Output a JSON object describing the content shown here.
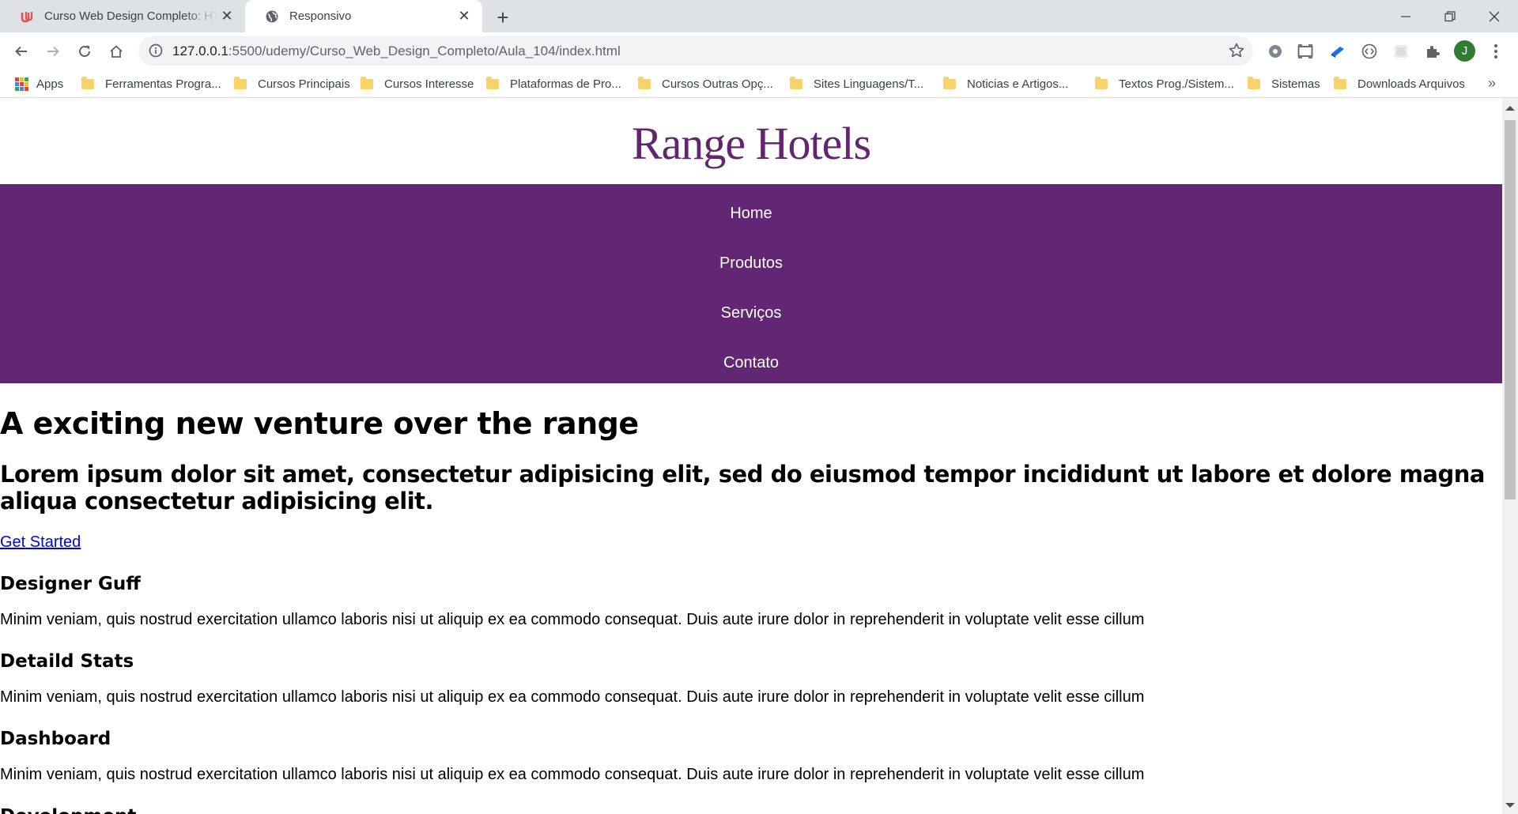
{
  "browser": {
    "tabs": [
      {
        "title": "Curso Web Design Completo: HT",
        "favicon": "udemy-icon",
        "active": false
      },
      {
        "title": "Responsivo",
        "favicon": "globe-icon",
        "active": true
      }
    ],
    "url_host": "127.0.0.1",
    "url_rest": ":5500/udemy/Curso_Web_Design_Completo/Aula_104/index.html",
    "avatar_initial": "J",
    "bookmarks": {
      "apps": "Apps",
      "items": [
        "Ferramentas Progra...",
        "Cursos Principais",
        "Cursos Interesse",
        "Plataformas de Pro...",
        "Cursos Outras Opç...",
        "Sites Linguagens/T...",
        "Noticias e Artigos...",
        "Textos Prog./Sistem...",
        "Sistemas",
        "Downloads Arquivos"
      ],
      "more": "»"
    }
  },
  "page": {
    "logo": "Range Hotels",
    "brand_color": "#622774",
    "nav": [
      "Home",
      "Produtos",
      "Serviços",
      "Contato"
    ],
    "headline": "A exciting new venture over the range",
    "subheadline": "Lorem ipsum dolor sit amet, consectetur adipisicing elit, sed do eiusmod tempor incididunt ut labore et dolore magna aliqua consectetur adipisicing elit.",
    "cta": "Get Started",
    "features": [
      {
        "title": "Designer Guff",
        "text": "Minim veniam, quis nostrud exercitation ullamco laboris nisi ut aliquip ex ea commodo consequat. Duis aute irure dolor in reprehenderit in voluptate velit esse cillum"
      },
      {
        "title": "Detaild Stats",
        "text": "Minim veniam, quis nostrud exercitation ullamco laboris nisi ut aliquip ex ea commodo consequat. Duis aute irure dolor in reprehenderit in voluptate velit esse cillum"
      },
      {
        "title": "Dashboard",
        "text": "Minim veniam, quis nostrud exercitation ullamco laboris nisi ut aliquip ex ea commodo consequat. Duis aute irure dolor in reprehenderit in voluptate velit esse cillum"
      },
      {
        "title": "Development",
        "text": ""
      }
    ]
  }
}
